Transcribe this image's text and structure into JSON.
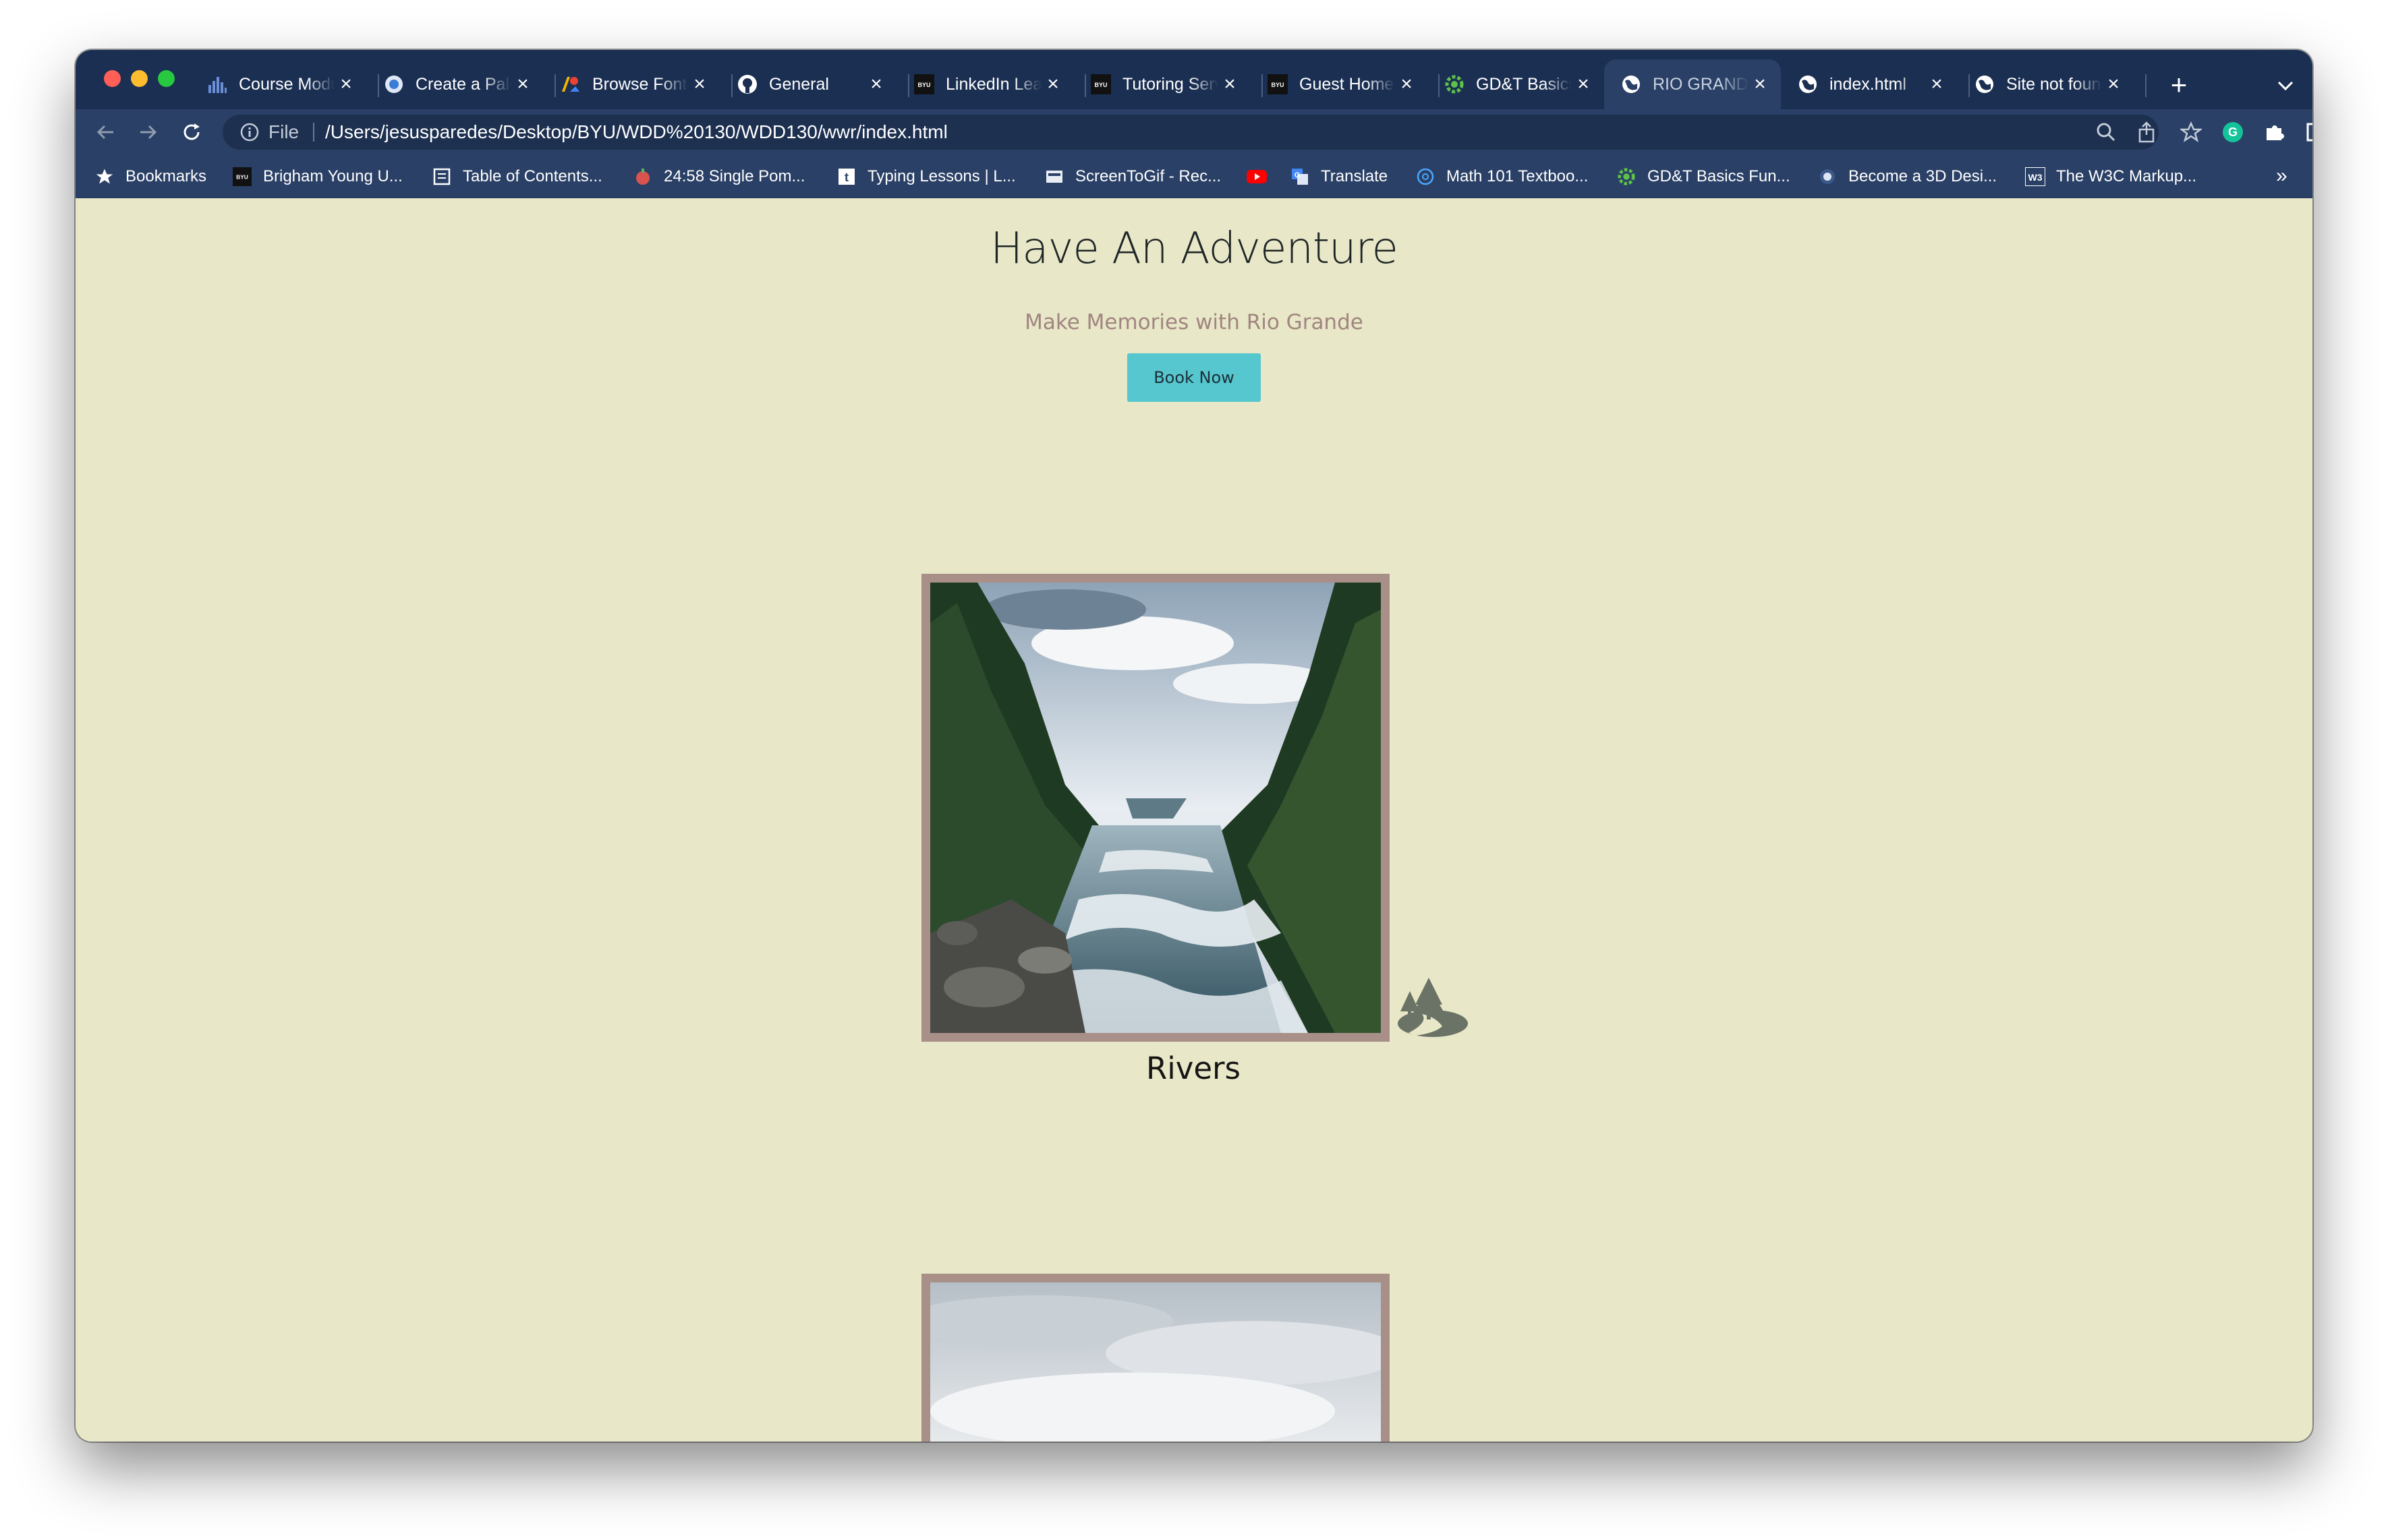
{
  "browser": {
    "tabs": [
      {
        "title": "Course Modules",
        "icon": "bar-chart-icon"
      },
      {
        "title": "Create a Palette",
        "icon": "palette-icon"
      },
      {
        "title": "Browse Fonts",
        "icon": "google-fonts-icon"
      },
      {
        "title": "General",
        "icon": "github-icon"
      },
      {
        "title": "LinkedIn Learning",
        "icon": "byu-icon"
      },
      {
        "title": "Tutoring Services",
        "icon": "byu-icon"
      },
      {
        "title": "Guest Home",
        "icon": "byu-icon"
      },
      {
        "title": "GD&T Basics",
        "icon": "gear-icon"
      },
      {
        "title": "RIO GRANDE",
        "icon": "globe-icon",
        "active": true
      },
      {
        "title": "index.html",
        "icon": "globe-icon"
      },
      {
        "title": "Site not found",
        "icon": "globe-icon"
      }
    ],
    "address_bar": {
      "scheme_label": "File",
      "url": "/Users/jesusparedes/Desktop/BYU/WDD%20130/WDD130/wwr/index.html"
    },
    "bookmarks": [
      {
        "label": "Bookmarks",
        "icon": "star-icon"
      },
      {
        "label": "Brigham Young U...",
        "icon": "byu-icon"
      },
      {
        "label": "Table of Contents...",
        "icon": "book-icon"
      },
      {
        "label": "24:58 Single Pom...",
        "icon": "tomato-icon"
      },
      {
        "label": "Typing Lessons | L...",
        "icon": "typing-icon"
      },
      {
        "label": "ScreenToGif - Rec...",
        "icon": "screentogif-icon"
      },
      {
        "label": "",
        "icon": "youtube-icon"
      },
      {
        "label": "Translate",
        "icon": "translate-icon"
      },
      {
        "label": "Math 101 Textboo...",
        "icon": "math-icon"
      },
      {
        "label": "GD&T Basics Fun...",
        "icon": "gear-icon"
      },
      {
        "label": "Become a 3D Desi...",
        "icon": "3d-icon"
      },
      {
        "label": "The W3C Markup...",
        "icon": "w3c-icon"
      }
    ],
    "bookmarks_overflow": "»",
    "new_tab_label": "+"
  },
  "page": {
    "title": "Have An Adventure",
    "subtitle": "Make Memories with Rio Grande",
    "cta_label": "Book Now",
    "cards": [
      {
        "caption": "Rivers",
        "image": "mountain river photo",
        "icon": "river-trees-icon"
      },
      {
        "caption": "",
        "image": "cloudy sky photo"
      }
    ]
  },
  "colors": {
    "page_background": "#e8e7c7",
    "button": "#56c6cf",
    "frame": "#a89088",
    "subtitle": "#a08580",
    "browser_chrome": "#2a4066"
  }
}
